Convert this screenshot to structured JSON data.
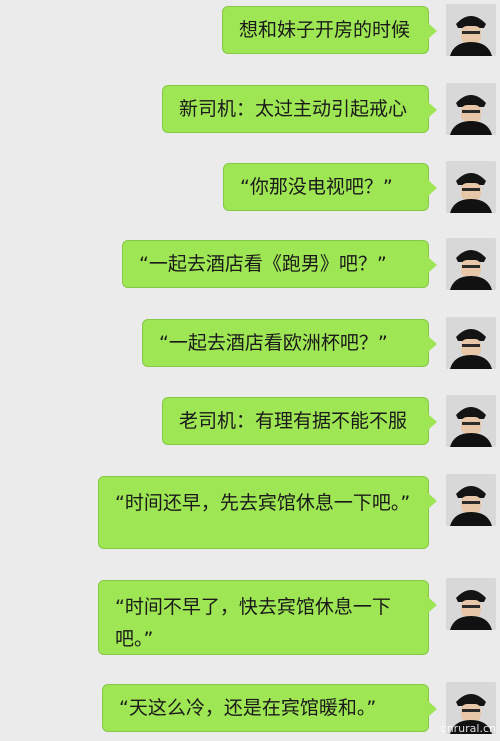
{
  "conversation": {
    "messages": [
      {
        "text": "想和妹子开房的时候"
      },
      {
        "text": "新司机：太过主动引起戒心"
      },
      {
        "text": "“你那没电视吧？”"
      },
      {
        "text": "“一起去酒店看《跑男》吧？”"
      },
      {
        "text": "“一起去酒店看欧洲杯吧？”"
      },
      {
        "text": "老司机：有理有据不能不服"
      },
      {
        "text": "“时间还早，先去宾馆休息一下吧。”"
      },
      {
        "text": "“时间不早了，快去宾馆休息一下吧。”"
      },
      {
        "text": "“天这么冷，还是在宾馆暖和。”"
      }
    ]
  },
  "watermark": "cnrural.cn",
  "colors": {
    "background": "#ebebeb",
    "bubble": "#9ee653",
    "bubble_border": "#86c846"
  }
}
